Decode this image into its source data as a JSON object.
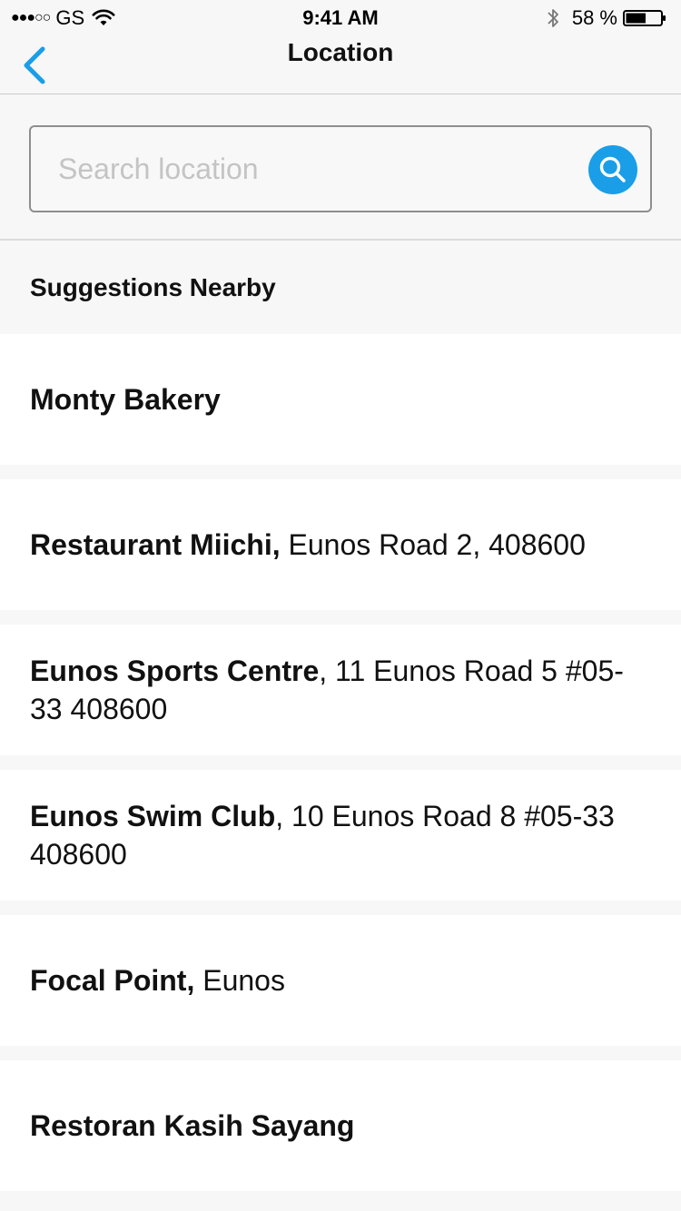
{
  "status_bar": {
    "signal": "●●●○○",
    "carrier": "GS",
    "time": "9:41 AM",
    "battery_percent": "58 %",
    "battery_level": 0.58
  },
  "nav": {
    "title": "Location",
    "accent_color": "#1a9ee8"
  },
  "search": {
    "placeholder": "Search location",
    "value": ""
  },
  "section": {
    "title": "Suggestions Nearby"
  },
  "suggestions": [
    {
      "name": "Monty Bakery",
      "address": ""
    },
    {
      "name": "Restaurant Miichi,",
      "address": " Eunos Road 2, 408600"
    },
    {
      "name": "Eunos Sports Centre",
      "address": ", 11 Eunos Road 5 #05-33 408600"
    },
    {
      "name": "Eunos Swim Club",
      "address": ", 10 Eunos Road 8 #05-33 408600"
    },
    {
      "name": "Focal Point,",
      "address": " Eunos"
    },
    {
      "name": "Restoran Kasih Sayang",
      "address": ""
    }
  ]
}
